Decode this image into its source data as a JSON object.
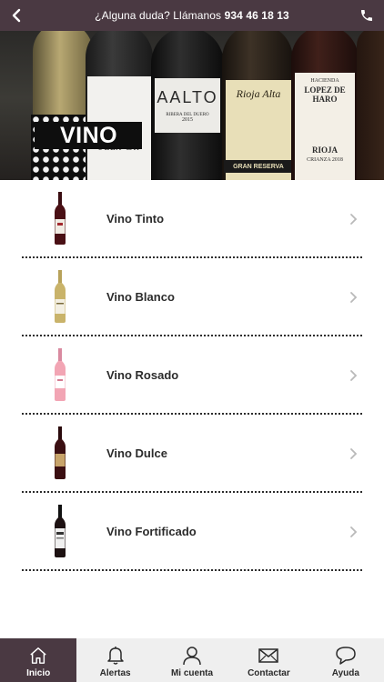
{
  "header": {
    "help_text": "¿Alguna duda? Llámanos",
    "phone": "934 46 18 13",
    "back_icon": "chevron-left-icon",
    "call_icon": "phone-icon"
  },
  "hero": {
    "banner": "VINO",
    "bottle_labels": {
      "aalto": "AALTO",
      "aalto_sub": "RIBERA DEL DUERO",
      "aalto_year": "2015",
      "rioja_alta": "Rioja Alta",
      "gran_reserva": "GRAN RESERVA",
      "lopez_haro": "LOPEZ DE HARO",
      "hacienda": "HACIENDA",
      "rioja": "RIOJA",
      "crianza": "CRIANZA 2018",
      "juan_gil": "Juan Gil"
    }
  },
  "categories": [
    {
      "label": "Vino Tinto",
      "bottle_color": "#4a1015",
      "label_color": "#f1ece4"
    },
    {
      "label": "Vino Blanco",
      "bottle_color": "#c9b36a",
      "label_color": "#f3efe2"
    },
    {
      "label": "Vino Rosado",
      "bottle_color": "#f2a5b4",
      "label_color": "#ffffff"
    },
    {
      "label": "Vino Dulce",
      "bottle_color": "#3b0f12",
      "label_color": "#c8a46a"
    },
    {
      "label": "Vino Fortificado",
      "bottle_color": "#1d1112",
      "label_color": "#f0f0f0"
    }
  ],
  "nav": {
    "items": [
      {
        "label": "Inicio",
        "icon": "home-icon",
        "active": true
      },
      {
        "label": "Alertas",
        "icon": "bell-icon",
        "active": false
      },
      {
        "label": "Mi cuenta",
        "icon": "user-icon",
        "active": false
      },
      {
        "label": "Contactar",
        "icon": "envelope-icon",
        "active": false
      },
      {
        "label": "Ayuda",
        "icon": "chat-bubble-icon",
        "active": false
      }
    ]
  },
  "colors": {
    "brand": "#4a3942",
    "nav_bg": "#efefef",
    "divider": "#2d2d2d"
  }
}
